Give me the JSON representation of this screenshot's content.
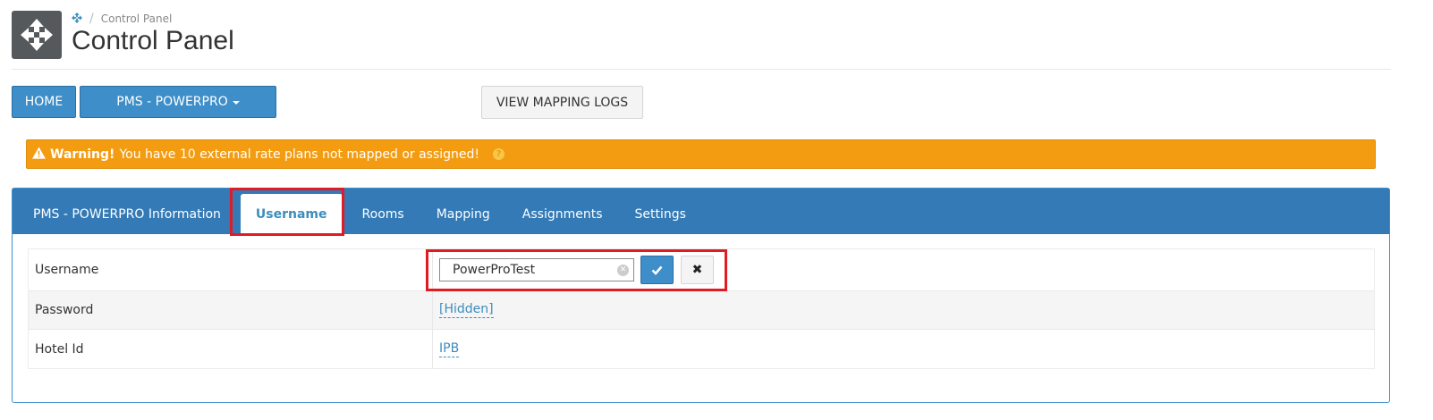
{
  "header": {
    "breadcrumb_icon": "move-icon",
    "breadcrumb_separator": "/",
    "breadcrumb": "Control Panel",
    "title": "Control Panel",
    "app_icon": "move-icon"
  },
  "toolbar": {
    "home_label": "HOME",
    "pms_label": "PMS - POWERPRO",
    "logs_label": "VIEW MAPPING LOGS"
  },
  "alert": {
    "strong": "Warning!",
    "text": "You have 10 external rate plans not mapped or assigned!",
    "icon": "warning-icon",
    "info_icon": "info-icon",
    "color": "#f39c12"
  },
  "tabs": [
    {
      "label": "PMS - POWERPRO Information"
    },
    {
      "label": "Username"
    },
    {
      "label": "Rooms"
    },
    {
      "label": "Mapping"
    },
    {
      "label": "Assignments"
    },
    {
      "label": "Settings"
    }
  ],
  "active_tab": "Username",
  "fields": {
    "username": {
      "label": "Username",
      "value": "PowerProTest"
    },
    "password": {
      "label": "Password",
      "value": "[Hidden]"
    },
    "hotel_id": {
      "label": "Hotel Id",
      "value": "IPB"
    }
  },
  "colors": {
    "primary": "#3d8ec9",
    "tabbar": "#337ab7",
    "highlight": "#e01b24"
  }
}
